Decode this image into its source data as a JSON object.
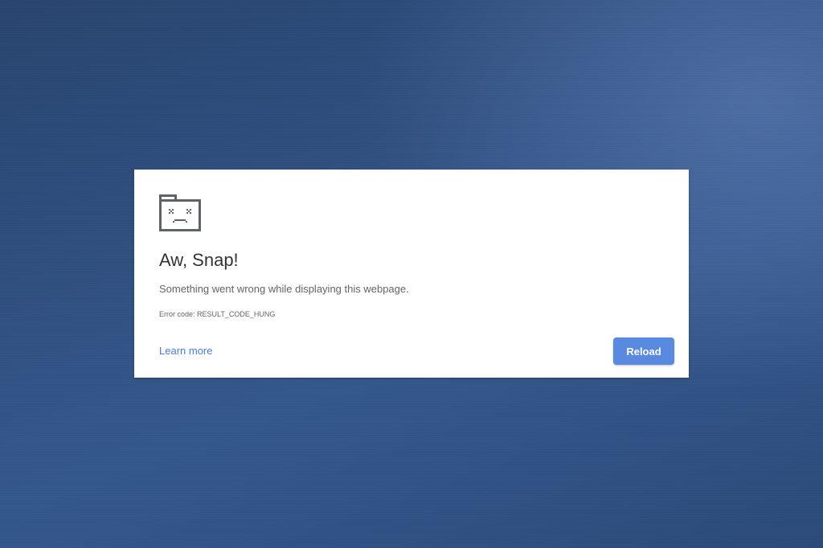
{
  "error_page": {
    "icon": "sad-tab-icon",
    "title": "Aw, Snap!",
    "message": "Something went wrong while displaying this webpage.",
    "error_code_text": "Error code: RESULT_CODE_HUNG",
    "learn_more_label": "Learn more",
    "reload_label": "Reload"
  },
  "colors": {
    "background": "#2f4f80",
    "card": "#ffffff",
    "title_text": "#333333",
    "body_text": "#646464",
    "link": "#4a7bd4",
    "button": "#5a8ae0",
    "button_text": "#ffffff",
    "icon": "#5f6368"
  }
}
